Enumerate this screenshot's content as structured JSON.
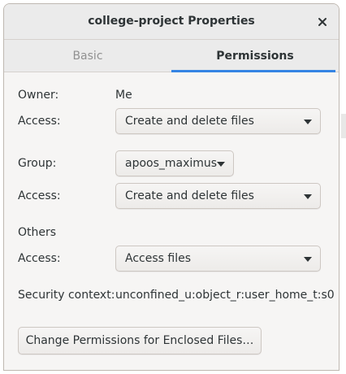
{
  "window": {
    "title": "college-project Properties",
    "close_icon": "close-icon"
  },
  "tabs": [
    {
      "label": "Basic",
      "active": false
    },
    {
      "label": "Permissions",
      "active": true
    }
  ],
  "owner": {
    "label": "Owner:",
    "value": "Me",
    "access_label": "Access:",
    "access_value": "Create and delete files"
  },
  "group": {
    "label": "Group:",
    "value": "apoos_maximus",
    "access_label": "Access:",
    "access_value": "Create and delete files"
  },
  "others": {
    "label": "Others",
    "access_label": "Access:",
    "access_value": "Access files"
  },
  "security": {
    "label": "Security context:",
    "value": "unconfined_u:object_r:user_home_t:s0"
  },
  "enclosed_button_label": "Change Permissions for Enclosed Files…",
  "colors": {
    "accent": "#3584e4",
    "text": "#2e3436",
    "inactive_tab": "#919191"
  }
}
